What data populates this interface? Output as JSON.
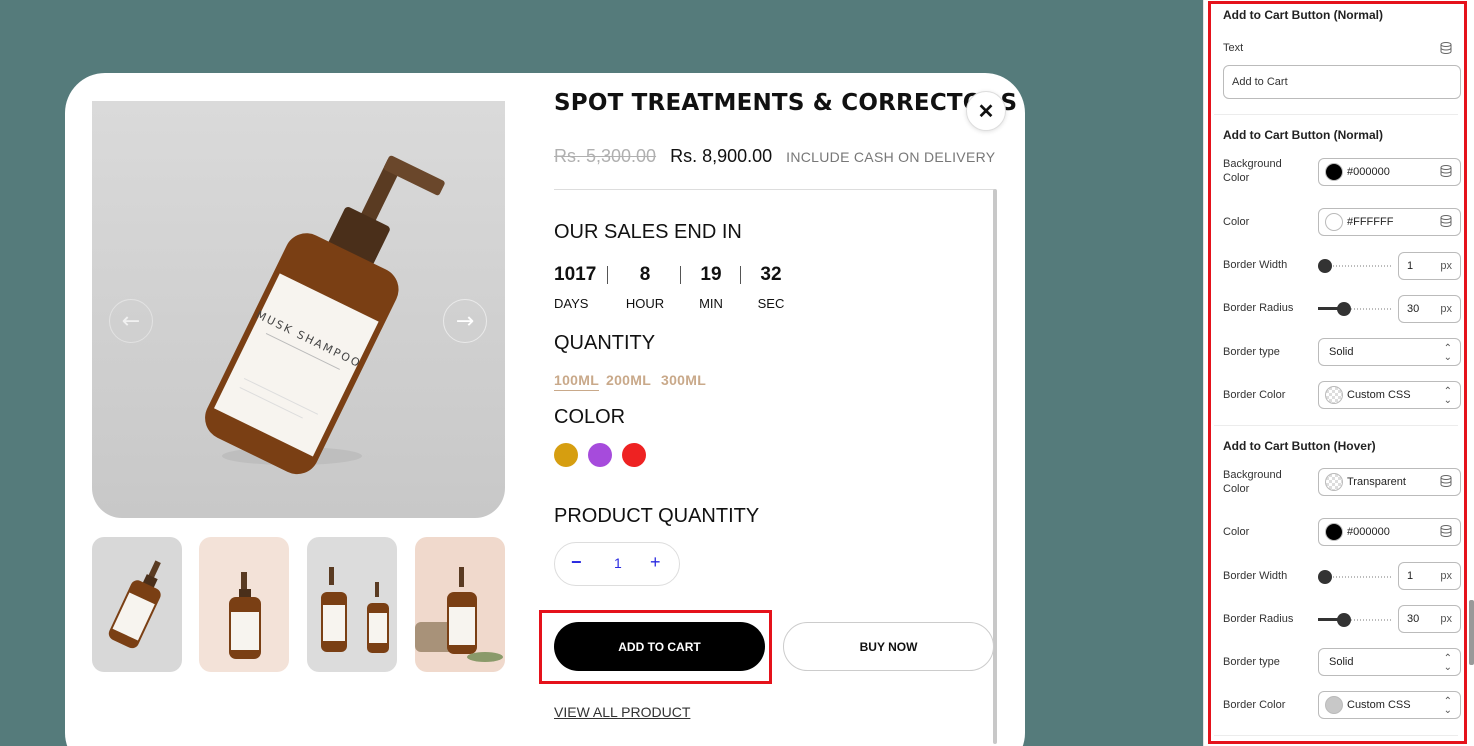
{
  "product": {
    "title": "SPOT TREATMENTS & CORRECTORS",
    "price_old": "Rs. 5,300.00",
    "price_new": "Rs. 8,900.00",
    "price_note": "INCLUDE CASH ON DELIVERY",
    "bottle_label": "MUSK SHAMPOO",
    "countdown_title": "OUR SALES END IN",
    "countdown": [
      {
        "value": "1017",
        "label": "DAYS"
      },
      {
        "value": "8",
        "label": "HOUR"
      },
      {
        "value": "19",
        "label": "MIN"
      },
      {
        "value": "32",
        "label": "SEC"
      }
    ],
    "quantity_title": "QUANTITY",
    "quantity_options": [
      "100ML",
      "200ML",
      "300ML"
    ],
    "selected_quantity": "100ML",
    "color_title": "COLOR",
    "colors": [
      "#d69e10",
      "#a64bdc",
      "#ee2222"
    ],
    "product_quantity_title": "PRODUCT QUANTITY",
    "stepper": {
      "minus": "−",
      "value": "1",
      "plus": "+"
    },
    "add_to_cart": "ADD TO CART",
    "buy_now": "BUY NOW",
    "view_all": "VIEW ALL PRODUCT",
    "close": "✕",
    "prev_arrow": "←",
    "next_arrow": "→"
  },
  "panel": {
    "top_heading": "Add to Cart Button (Normal)",
    "text_label": "Text",
    "text_value": "Add to Cart",
    "normal": {
      "heading": "Add to Cart Button (Normal)",
      "background_color_label": "Background Color",
      "background_color": "#000000",
      "color_label": "Color",
      "color": "#FFFFFF",
      "border_width_label": "Border Width",
      "border_width": "1",
      "border_radius_label": "Border Radius",
      "border_radius": "30",
      "unit": "px",
      "border_type_label": "Border type",
      "border_type": "Solid",
      "border_color_label": "Border Color",
      "border_color": "Custom CSS"
    },
    "hover": {
      "heading": "Add to Cart Button (Hover)",
      "background_color_label": "Background Color",
      "background_color": "Transparent",
      "color_label": "Color",
      "color": "#000000",
      "border_width_label": "Border Width",
      "border_width": "1",
      "border_radius_label": "Border Radius",
      "border_radius": "30",
      "unit": "px",
      "border_type_label": "Border type",
      "border_type": "Solid",
      "border_color_label": "Border Color",
      "border_color": "Custom CSS"
    }
  }
}
